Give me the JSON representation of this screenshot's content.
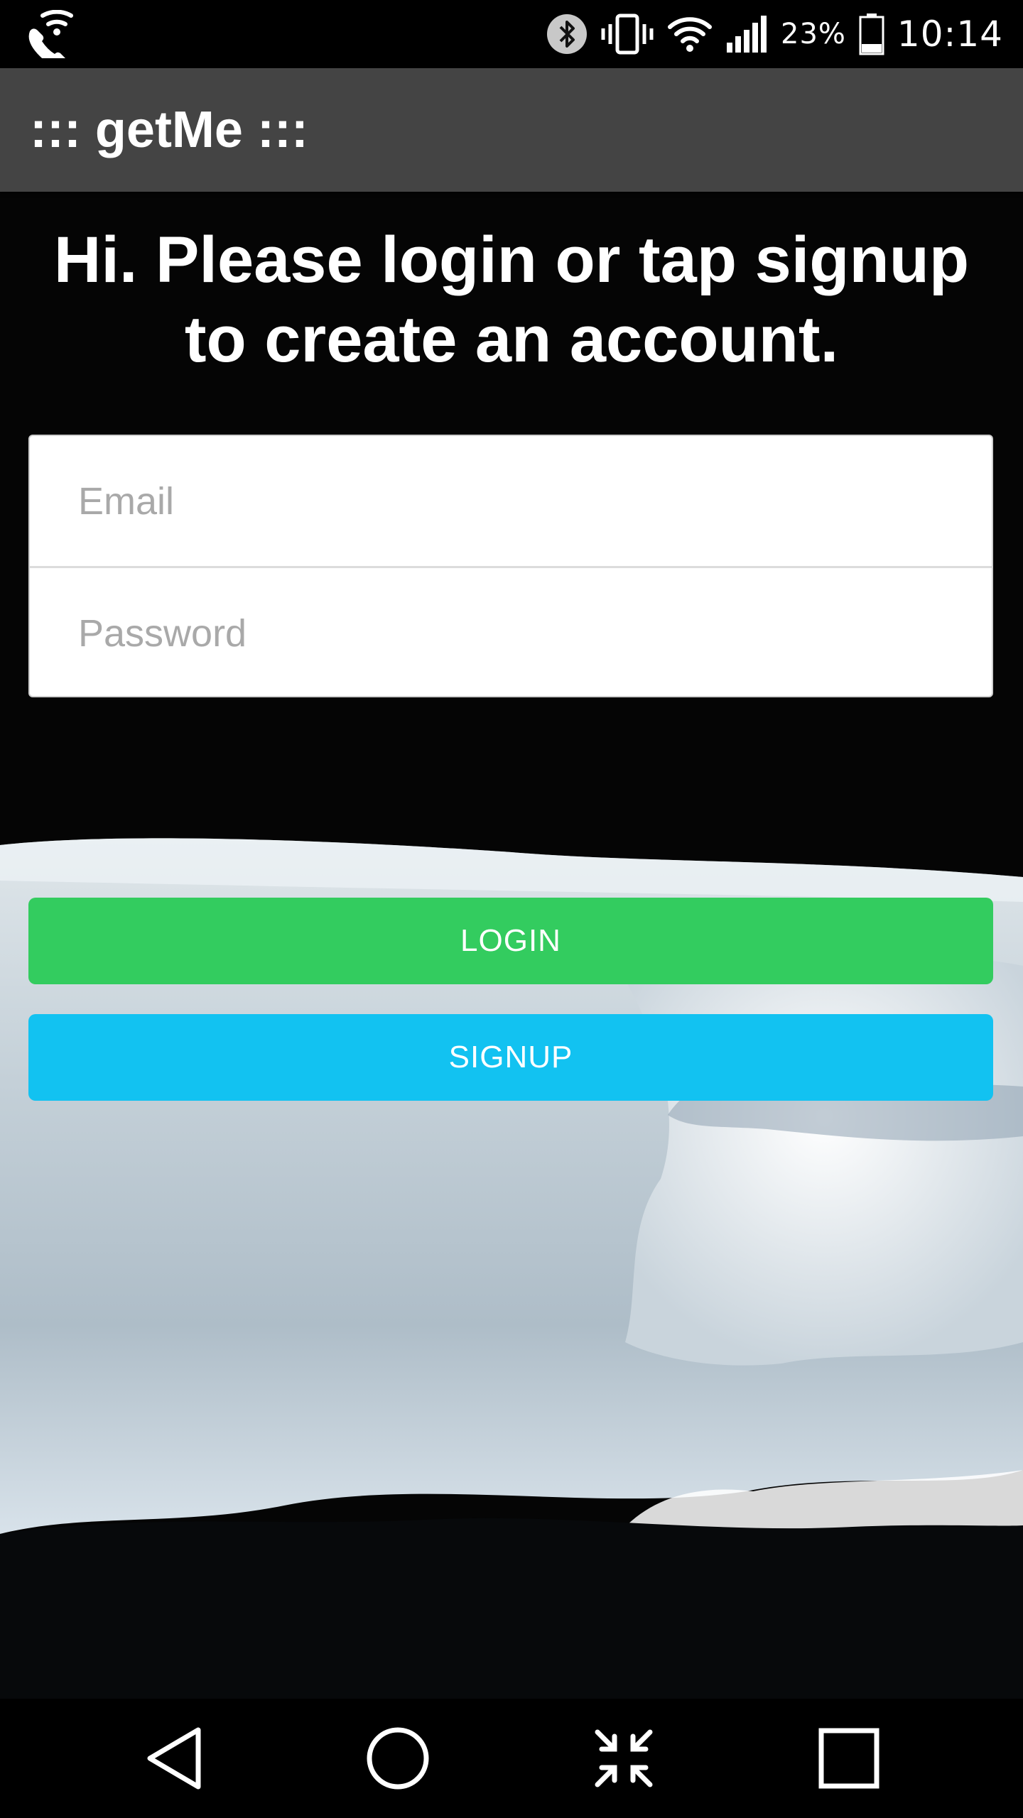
{
  "status_bar": {
    "left_icon": "wifi-calling-icon",
    "icons": [
      "bluetooth-icon",
      "vibrate-icon",
      "wifi-icon",
      "signal-icon",
      "battery-icon"
    ],
    "battery_percent": "23%",
    "time": "10:14"
  },
  "action_bar": {
    "title": "::: getMe :::"
  },
  "login": {
    "welcome_message": "Hi. Please login or tap signup to create an account.",
    "email_placeholder": "Email",
    "email_value": "",
    "password_placeholder": "Password",
    "password_value": "",
    "login_label": "LOGIN",
    "signup_label": "SIGNUP"
  },
  "nav_bar": {
    "icons": [
      "back-icon",
      "home-icon",
      "dual-window-icon",
      "recent-apps-icon"
    ]
  },
  "colors": {
    "action_bar": "#444444",
    "login_button": "#33cc5f",
    "signup_button": "#12c2f1",
    "background": "#000000"
  }
}
